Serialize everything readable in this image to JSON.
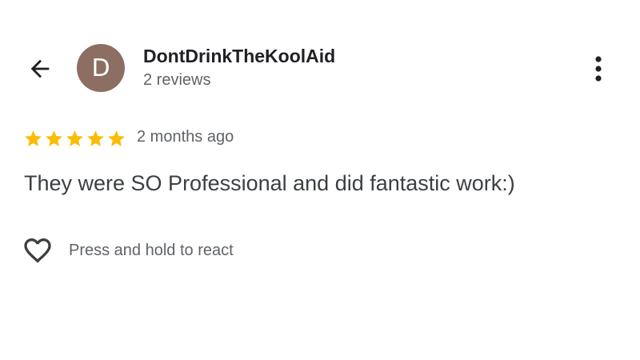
{
  "header": {
    "back_icon": "arrow-left-icon",
    "avatar_letter": "D",
    "avatar_color": "#8d6e63",
    "user_name": "DontDrinkTheKoolAid",
    "review_count": "2 reviews",
    "more_icon": "more-vert-icon"
  },
  "review": {
    "rating": 5,
    "max_rating": 5,
    "star_color": "#fbbc04",
    "star_icon": "star-icon",
    "date": "2 months ago",
    "text": "They were SO Professional and did fantastic work:)"
  },
  "reaction": {
    "icon": "heart-outline-icon",
    "label": "Press and hold to react"
  }
}
